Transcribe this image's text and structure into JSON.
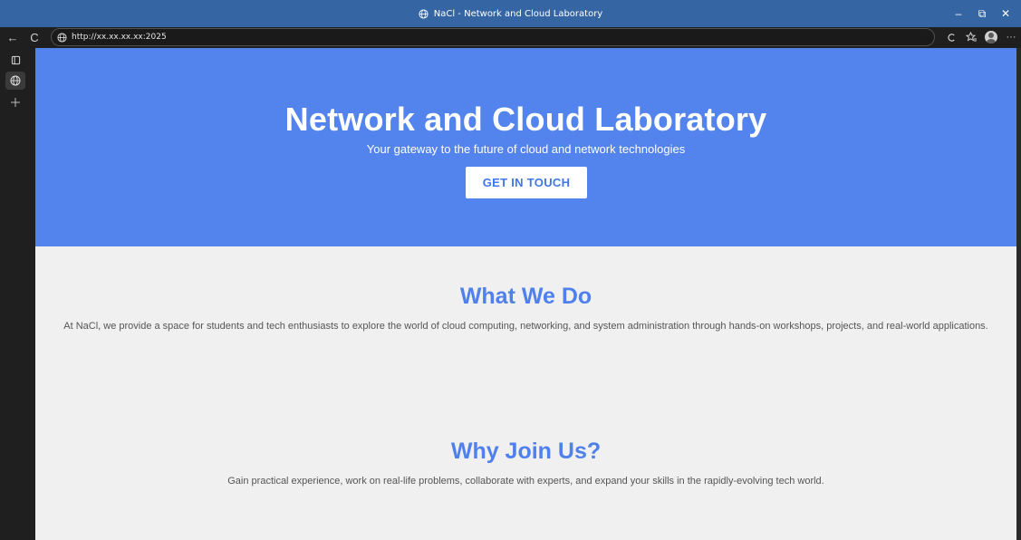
{
  "window": {
    "title": "NaCl - Network and Cloud Laboratory",
    "minimize_glyph": "–",
    "restore_glyph": "⧉",
    "close_glyph": "✕"
  },
  "toolbar": {
    "back_glyph": "←",
    "reload_glyph": "C",
    "url": "http://xx.xx.xx.xx:2025",
    "more_glyph": "···"
  },
  "hero": {
    "title": "Network and Cloud Laboratory",
    "subtitle": "Your gateway to the future of cloud and network technologies",
    "cta_label": "GET IN TOUCH"
  },
  "what_we_do": {
    "heading": "What We Do",
    "body": "At NaCl, we provide a space for students and tech enthusiasts to explore the world of cloud computing, networking, and system administration through hands-on workshops, projects, and real-world applications."
  },
  "why_join": {
    "heading": "Why Join Us?",
    "body": "Gain practical experience, work on real-life problems, collaborate with experts, and expand your skills in the rapidly-evolving tech world."
  },
  "icons": {
    "tab_favicon": "globe-icon",
    "address_site_info": "globe-icon",
    "sidebar": [
      "tab-actions-icon",
      "globe-icon",
      "plus-icon"
    ],
    "toolbar_right": [
      "read-aloud-icon",
      "favorites-icon",
      "profile-avatar-icon",
      "more-icon"
    ]
  },
  "colors": {
    "titlebar": "#3565a3",
    "hero_bg": "#5383ed",
    "heading_blue": "#4f80ec",
    "page_bg": "#f0f0f0",
    "body_text": "#555555"
  }
}
